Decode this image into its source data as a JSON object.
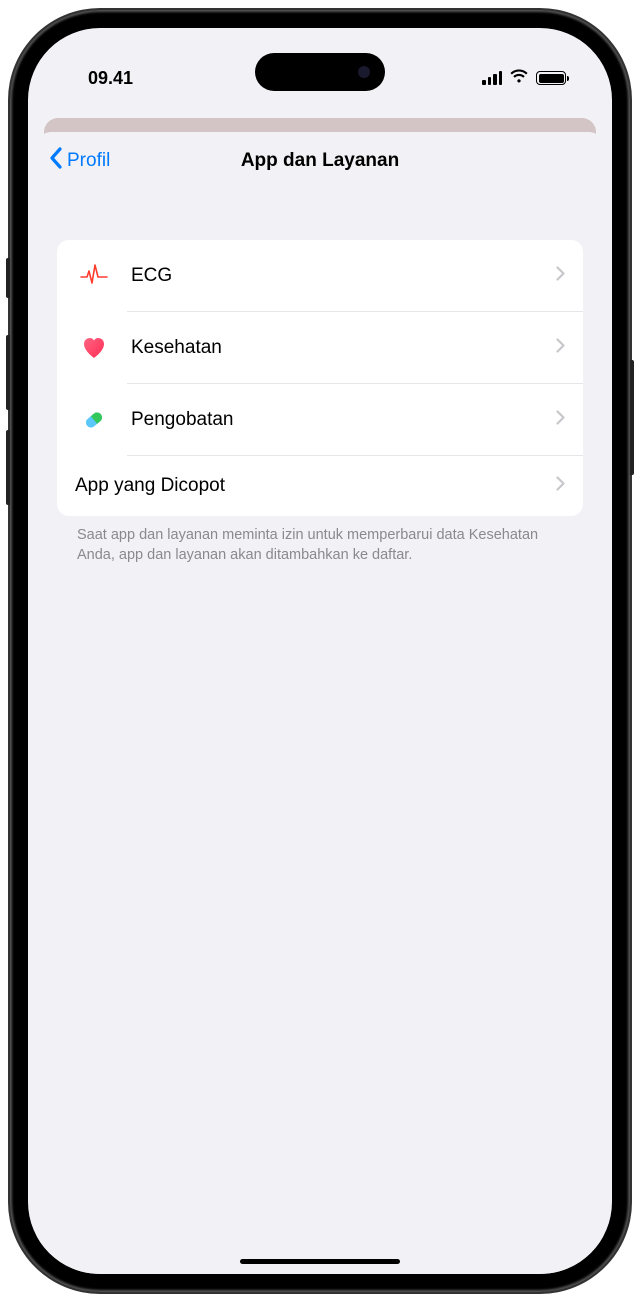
{
  "status": {
    "time": "09.41"
  },
  "nav": {
    "back_label": "Profil",
    "title": "App dan Layanan"
  },
  "list": {
    "items": [
      {
        "label": "ECG",
        "icon": "ecg-icon"
      },
      {
        "label": "Kesehatan",
        "icon": "health-icon"
      },
      {
        "label": "Pengobatan",
        "icon": "medication-icon"
      }
    ],
    "uninstalled_label": "App yang Dicopot"
  },
  "footer": {
    "text": "Saat app dan layanan meminta izin untuk memperbarui data Kesehatan Anda, app dan layanan akan ditambahkan ke daftar."
  }
}
